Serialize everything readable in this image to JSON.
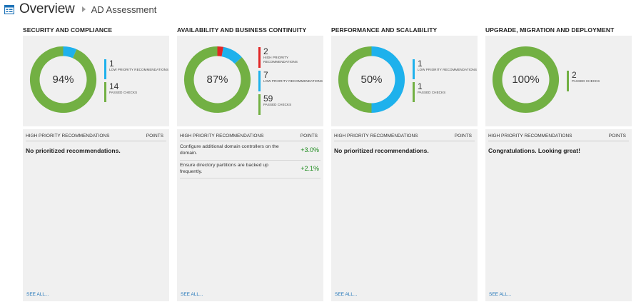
{
  "header": {
    "title": "Overview",
    "breadcrumb": "AD Assessment"
  },
  "colors": {
    "green": "#72b043",
    "blue": "#1eb1ec",
    "red": "#e12727",
    "link": "#1e73b8"
  },
  "columns": [
    {
      "title": "SECURITY AND COMPLIANCE",
      "percent": "94%",
      "segments": [
        {
          "color": "#1eb1ec",
          "value": 1
        },
        {
          "color": "#72b043",
          "value": 14
        }
      ],
      "legend": [
        {
          "count": "1",
          "label": "LOW PRIORITY RECOMMENDATIONS",
          "color": "#1eb1ec"
        },
        {
          "count": "14",
          "label": "PASSED CHECKS",
          "color": "#72b043"
        }
      ],
      "list_header": "HIGH PRIORITY RECOMMENDATIONS",
      "points_header": "POINTS",
      "empty_text": "No prioritized recommendations.",
      "recs": [],
      "see_all": "SEE ALL..."
    },
    {
      "title": "AVAILABILITY AND BUSINESS CONTINUITY",
      "percent": "87%",
      "segments": [
        {
          "color": "#e12727",
          "value": 2
        },
        {
          "color": "#1eb1ec",
          "value": 7
        },
        {
          "color": "#72b043",
          "value": 59
        }
      ],
      "legend": [
        {
          "count": "2",
          "label": "HIGH PRIORITY RECOMMENDATIONS",
          "color": "#e12727"
        },
        {
          "count": "7",
          "label": "LOW PRIORITY RECOMMENDATIONS",
          "color": "#1eb1ec"
        },
        {
          "count": "59",
          "label": "PASSED CHECKS",
          "color": "#72b043"
        }
      ],
      "list_header": "HIGH PRIORITY RECOMMENDATIONS",
      "points_header": "POINTS",
      "empty_text": "",
      "recs": [
        {
          "text": "Configure additional domain controllers on the domain.",
          "points": "+3.0%"
        },
        {
          "text": "Ensure directory partitions are backed up frequently.",
          "points": "+2.1%"
        }
      ],
      "see_all": "SEE ALL..."
    },
    {
      "title": "PERFORMANCE AND SCALABILITY",
      "percent": "50%",
      "segments": [
        {
          "color": "#1eb1ec",
          "value": 1
        },
        {
          "color": "#72b043",
          "value": 1
        }
      ],
      "legend": [
        {
          "count": "1",
          "label": "LOW PRIORITY RECOMMENDATIONS",
          "color": "#1eb1ec"
        },
        {
          "count": "1",
          "label": "PASSED CHECKS",
          "color": "#72b043"
        }
      ],
      "list_header": "HIGH PRIORITY RECOMMENDATIONS",
      "points_header": "POINTS",
      "empty_text": "No prioritized recommendations.",
      "recs": [],
      "see_all": "SEE ALL..."
    },
    {
      "title": "UPGRADE, MIGRATION AND DEPLOYMENT",
      "percent": "100%",
      "segments": [
        {
          "color": "#72b043",
          "value": 2
        }
      ],
      "legend": [
        {
          "count": "2",
          "label": "PASSED CHECKS",
          "color": "#72b043"
        }
      ],
      "list_header": "HIGH PRIORITY RECOMMENDATIONS",
      "points_header": "POINTS",
      "empty_text": "Congratulations. Looking great!",
      "recs": [],
      "see_all": "SEE ALL..."
    }
  ]
}
